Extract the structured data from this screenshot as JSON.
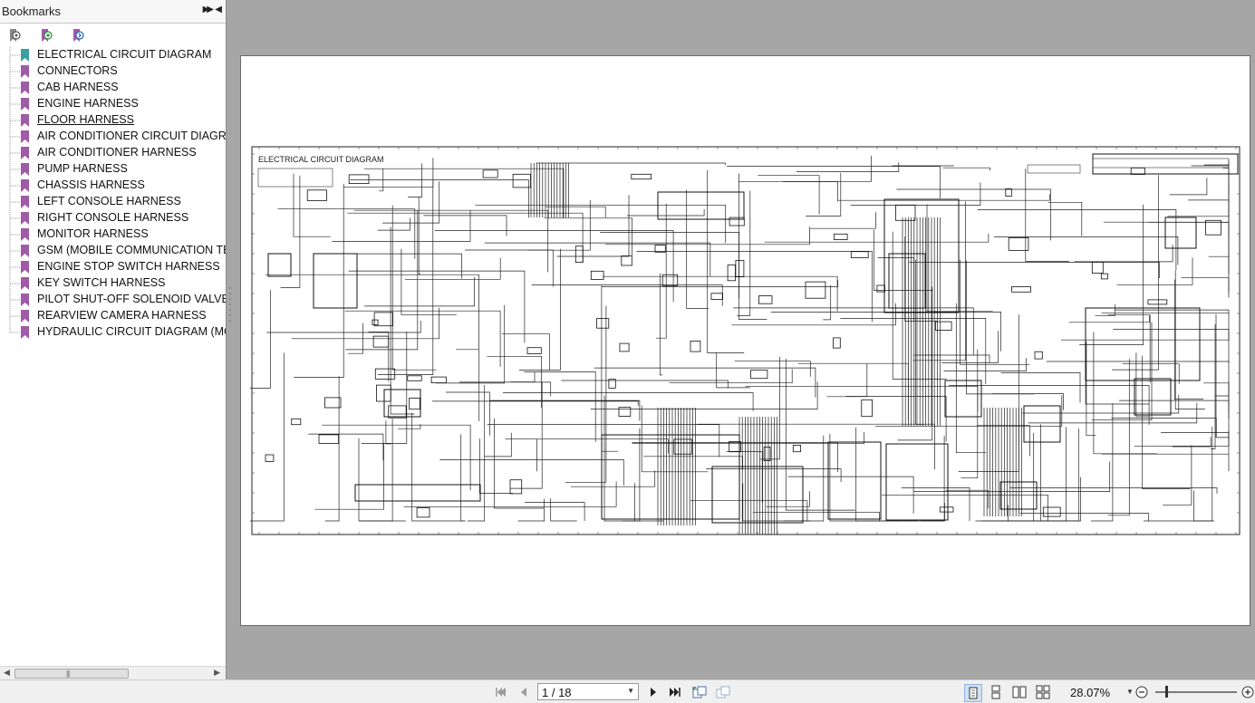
{
  "sidebar": {
    "title": "Bookmarks",
    "items": [
      {
        "label": "ELECTRICAL CIRCUIT DIAGRAM",
        "color": "#3a9f9f"
      },
      {
        "label": "CONNECTORS",
        "color": "#a05aa8"
      },
      {
        "label": "CAB HARNESS",
        "color": "#a05aa8"
      },
      {
        "label": "ENGINE HARNESS",
        "color": "#a05aa8"
      },
      {
        "label": "FLOOR HARNESS",
        "color": "#a05aa8"
      },
      {
        "label": "AIR CONDITIONER CIRCUIT DIAGRAM",
        "color": "#a05aa8"
      },
      {
        "label": "AIR CONDITIONER HARNESS",
        "color": "#a05aa8"
      },
      {
        "label": "PUMP HARNESS",
        "color": "#a05aa8"
      },
      {
        "label": "CHASSIS HARNESS",
        "color": "#a05aa8"
      },
      {
        "label": "LEFT CONSOLE HARNESS",
        "color": "#a05aa8"
      },
      {
        "label": "RIGHT CONSOLE HARNESS",
        "color": "#a05aa8"
      },
      {
        "label": "MONITOR HARNESS",
        "color": "#a05aa8"
      },
      {
        "label": "GSM (MOBILE COMMUNICATION TERMINAL)",
        "color": "#a05aa8"
      },
      {
        "label": "ENGINE STOP SWITCH HARNESS",
        "color": "#a05aa8"
      },
      {
        "label": "KEY SWITCH HARNESS",
        "color": "#a05aa8"
      },
      {
        "label": "PILOT SHUT-OFF SOLENOID VALVE HARNESS",
        "color": "#a05aa8"
      },
      {
        "label": "REARVIEW CAMERA HARNESS",
        "color": "#a05aa8"
      },
      {
        "label": "HYDRAULIC CIRCUIT DIAGRAM (MONOBLOCK)",
        "color": "#a05aa8"
      }
    ]
  },
  "document": {
    "diagram_title": "ELECTRICAL CIRCUIT DIAGRAM"
  },
  "toolbar": {
    "page_display": "1 / 18",
    "zoom": "28.07%"
  },
  "colors": {
    "viewer_bg": "#a6a6a6",
    "accent_bookmark": "#3a9f9f",
    "bookmark": "#a05aa8"
  }
}
